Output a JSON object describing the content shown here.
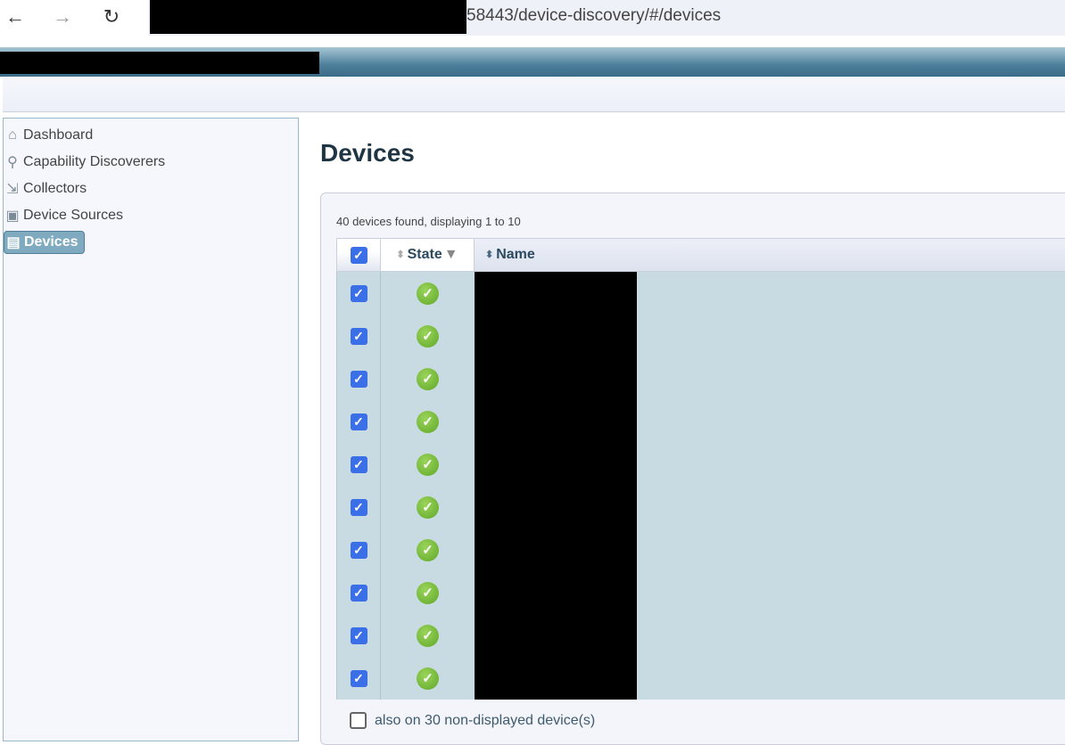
{
  "browser": {
    "back": "←",
    "forward": "→",
    "reload": "↻",
    "url_visible": "58443/device-discovery/#/devices"
  },
  "sidebar": {
    "items": [
      {
        "label": "Dashboard",
        "icon": "home-icon",
        "glyph": "⌂"
      },
      {
        "label": "Capability Discoverers",
        "icon": "telescope-icon",
        "glyph": "⚲"
      },
      {
        "label": "Collectors",
        "icon": "collector-icon",
        "glyph": "⇲"
      },
      {
        "label": "Device Sources",
        "icon": "device-source-icon",
        "glyph": "▣"
      },
      {
        "label": "Devices",
        "icon": "devices-icon",
        "glyph": "▤",
        "active": true
      }
    ]
  },
  "main": {
    "title": "Devices",
    "count_text": "40 devices found, displaying 1 to 10",
    "columns": {
      "state": "State",
      "name": "Name"
    },
    "rows": [
      {
        "checked": true,
        "state": "ok"
      },
      {
        "checked": true,
        "state": "ok"
      },
      {
        "checked": true,
        "state": "ok"
      },
      {
        "checked": true,
        "state": "ok"
      },
      {
        "checked": true,
        "state": "ok"
      },
      {
        "checked": true,
        "state": "ok"
      },
      {
        "checked": true,
        "state": "ok"
      },
      {
        "checked": true,
        "state": "ok"
      },
      {
        "checked": true,
        "state": "ok"
      },
      {
        "checked": true,
        "state": "ok"
      }
    ],
    "also_label": "also on 30 non-displayed device(s)"
  },
  "colors": {
    "accent": "#3b6fe8",
    "ok": "#6cb33a",
    "header": "#3a6b88",
    "row": "#c9dbe2"
  }
}
